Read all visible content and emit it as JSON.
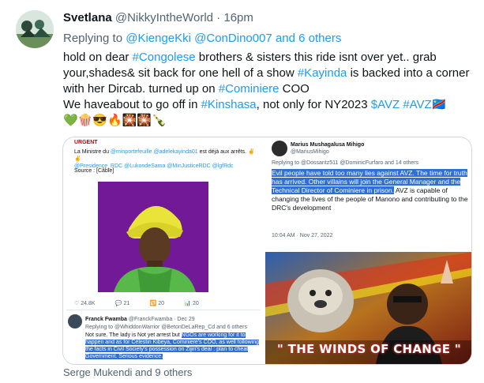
{
  "tweet": {
    "display_name": "Svetlana",
    "handle": "@NikkyIntheWorld",
    "separator": "·",
    "time": "16pm",
    "replying_prefix": "Replying to",
    "replying_to": "@KiengeKki @ConDino007 and 6 others",
    "text_line1_a": "hold on dear ",
    "hashtag_congolese": "#Congolese",
    "text_line1_b": " brothers & sisters this ride isnt over yet.. grab your,shades& sit back for one hell of a show ",
    "hashtag_kayinda": "#Kayinda",
    "text_line1_c": " is backed into a corner with her Dircab.  turned up on ",
    "hashtag_cominiere": "#Cominiere",
    "text_line1_d": " COO",
    "text_line2_a": "We haveabout to go off in ",
    "hashtag_kinshasa": "#Kinshasa",
    "text_line2_b": ", not only for NY2023 ",
    "cashtag_avz": "$AVZ",
    "hashtag_avz": "#AVZ",
    "emoji_line": "💚🍿😎🔥🎇🎇🍾",
    "flag_emoji": "🇨🇩"
  },
  "media": {
    "left": {
      "top_label": "URGENT",
      "caption_a": "La Ministre du ",
      "caption_link_a": "@minportefeuille @adelekayinda01",
      "caption_b": " est déjà aux arrêts.",
      "caption_link_b": "@Presidence_RDC @LukondeSama @MinJusticeRDC @lgfRdc",
      "source": "Source : [Câble]",
      "stat_likes": "24.8K",
      "stat_replies": "21",
      "stat_retweets": "20",
      "stat_views": "20",
      "reply_name": "Franck Fwamba",
      "reply_handle": "@FranckFwamba · Dec 29",
      "reply_to": "Replying to @WhiddonWarrior @BetonDeLaRep_Cd and 6 others",
      "reply_text_a": "Not sure. The lady is Not yet arrest but ",
      "reply_text_hl": "NGOs are working for it to happen and as for Célestin Kibeya, Cominiere's COO, as well following the facts in Civil Society's possession on Zijin's deal : plan to cheat Government. Serious evidence."
    },
    "right_top": {
      "name": "Marius Mushagalusa Mihigo",
      "handle": "@MariusMihigo",
      "replying": "Replying to @Dossantz511 @DominicFurfaro and 14 others",
      "hl_text": "Evil people have told too many lies against AVZ. The time for truth has arrived. Other villains will join the General Manager and the Technical Director of Cominiere in prison.",
      "plain_text": " AVZ is  capable of changing the lives of the people of Manono and contributing to the DRC's development",
      "timestamp": "10:04 AM · Nov 27, 2022"
    },
    "right_bottom": {
      "banner": "\" THE WINDS OF CHANGE \""
    }
  },
  "footer": {
    "tagged": "Serge Mukendi and 9 others"
  },
  "colors": {
    "link": "#1d9bf0",
    "muted": "#536471",
    "highlight": "#2f6fd6"
  }
}
